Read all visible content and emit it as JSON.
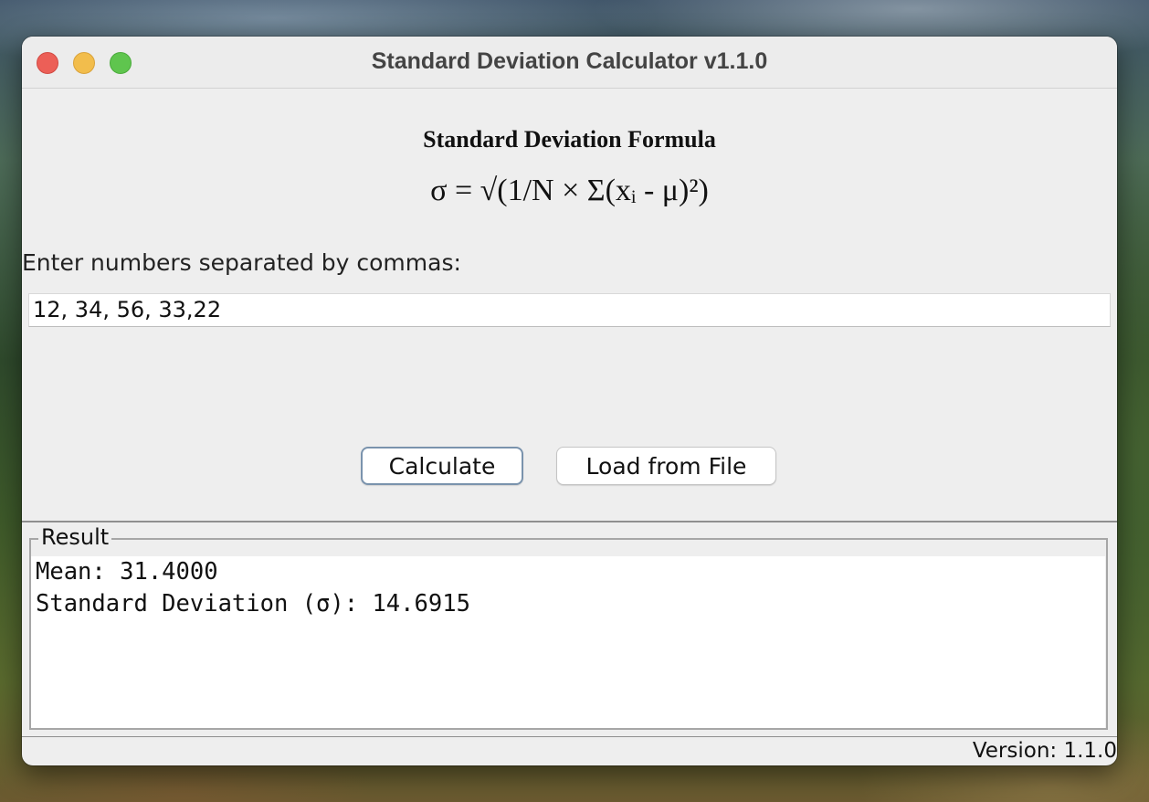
{
  "window": {
    "title": "Standard Deviation Calculator v1.1.0"
  },
  "formula": {
    "heading": "Standard Deviation Formula",
    "expression": "σ = √(1/N × Σ(xᵢ - μ)²)"
  },
  "input": {
    "label": "Enter numbers separated by commas:",
    "value": "12, 34, 56, 33,22"
  },
  "buttons": {
    "calculate": "Calculate",
    "load": "Load from File"
  },
  "result": {
    "legend": "Result",
    "lines": [
      "Mean: 31.4000",
      "Standard Deviation (σ): 14.6915"
    ]
  },
  "status": {
    "version": "Version: 1.1.0"
  },
  "icons": {
    "close": "close-icon",
    "minimize": "minimize-icon",
    "maximize": "maximize-icon"
  },
  "colors": {
    "close": "#ec5f57",
    "minimize": "#f2bd4c",
    "maximize": "#5fc54e",
    "focus_border": "#7a93ad"
  }
}
